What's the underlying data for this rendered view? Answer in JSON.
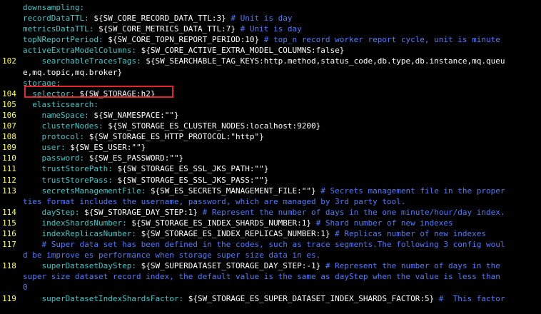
{
  "editor": {
    "highlight_color": "#e0262a",
    "colors": {
      "key": "#3fc7c7",
      "value": "#ffffff",
      "comment": "#4e7bff",
      "line_number": "#ffff55"
    },
    "lines": [
      {
        "num": "",
        "indent": "",
        "key": "downsampling:",
        "value": "",
        "comment": ""
      },
      {
        "num": "",
        "indent": "",
        "key": "recordDataTTL:",
        "value": " ${SW_CORE_RECORD_DATA_TTL:3}",
        "comment": " # Unit is day"
      },
      {
        "num": "",
        "indent": "",
        "key": "metricsDataTTL:",
        "value": " ${SW_CORE_METRICS_DATA_TTL:7}",
        "comment": " # Unit is day"
      },
      {
        "num": "",
        "indent": "",
        "key": "topNReportPeriod:",
        "value": " ${SW_CORE_TOPN_REPORT_PERIOD:10}",
        "comment": " # top_n record worker report cycle, unit is minute"
      },
      {
        "num": "",
        "indent": "",
        "key": "activeExtraModelColumns:",
        "value": " ${SW_CORE_ACTIVE_EXTRA_MODEL_COLUMNS:false}",
        "comment": ""
      },
      {
        "num": "102",
        "indent": "    ",
        "key": "searchableTracesTags:",
        "value": " ${SW_SEARCHABLE_TAG_KEYS:http.method,status_code,db.type,db.instance,mq.queu",
        "comment": ""
      },
      {
        "num": "",
        "indent": "",
        "key": "",
        "value": "e,mq.topic,mq.broker}",
        "comment": ""
      },
      {
        "num": "",
        "indent": "",
        "key": "storage:",
        "value": "",
        "comment": ""
      },
      {
        "num": "104",
        "indent": "  ",
        "key": "selector:",
        "value": " ${SW_STORAGE:h2}",
        "comment": ""
      },
      {
        "num": "105",
        "indent": "  ",
        "key": "elasticsearch:",
        "value": "",
        "comment": ""
      },
      {
        "num": "106",
        "indent": "    ",
        "key": "nameSpace:",
        "value": " ${SW_NAMESPACE:\"\"}",
        "comment": ""
      },
      {
        "num": "107",
        "indent": "    ",
        "key": "clusterNodes:",
        "value": " ${SW_STORAGE_ES_CLUSTER_NODES:localhost:9200}",
        "comment": ""
      },
      {
        "num": "108",
        "indent": "    ",
        "key": "protocol:",
        "value": " ${SW_STORAGE_ES_HTTP_PROTOCOL:\"http\"}",
        "comment": ""
      },
      {
        "num": "109",
        "indent": "    ",
        "key": "user:",
        "value": " ${SW_ES_USER:\"\"}",
        "comment": ""
      },
      {
        "num": "110",
        "indent": "    ",
        "key": "password:",
        "value": " ${SW_ES_PASSWORD:\"\"}",
        "comment": ""
      },
      {
        "num": "111",
        "indent": "    ",
        "key": "trustStorePath:",
        "value": " ${SW_STORAGE_ES_SSL_JKS_PATH:\"\"}",
        "comment": ""
      },
      {
        "num": "112",
        "indent": "    ",
        "key": "trustStorePass:",
        "value": " ${SW_STORAGE_ES_SSL_JKS_PASS:\"\"}",
        "comment": ""
      },
      {
        "num": "113",
        "indent": "    ",
        "key": "secretsManagementFile:",
        "value": " ${SW_ES_SECRETS_MANAGEMENT_FILE:\"\"}",
        "comment": " # Secrets management file in the proper"
      },
      {
        "num": "",
        "indent": "",
        "key": "",
        "value": "",
        "comment": "ties format includes the username, password, which are managed by 3rd party tool."
      },
      {
        "num": "114",
        "indent": "    ",
        "key": "dayStep:",
        "value": " ${SW_STORAGE_DAY_STEP:1}",
        "comment": " # Represent the number of days in the one minute/hour/day index."
      },
      {
        "num": "115",
        "indent": "    ",
        "key": "indexShardsNumber:",
        "value": " ${SW_STORAGE_ES_INDEX_SHARDS_NUMBER:1}",
        "comment": " # Shard number of new indexes"
      },
      {
        "num": "116",
        "indent": "    ",
        "key": "indexReplicasNumber:",
        "value": " ${SW_STORAGE_ES_INDEX_REPLICAS_NUMBER:1}",
        "comment": " # Replicas number of new indexes"
      },
      {
        "num": "117",
        "indent": "    ",
        "key": "",
        "value": "",
        "comment": "# Super data set has been defined in the codes, such as trace segments.The following 3 config woul"
      },
      {
        "num": "",
        "indent": "",
        "key": "",
        "value": "",
        "comment": "d be improve es performance when storage super size data in es."
      },
      {
        "num": "118",
        "indent": "    ",
        "key": "superDatasetDayStep:",
        "value": " ${SW_SUPERDATASET_STORAGE_DAY_STEP:-1}",
        "comment": " # Represent the number of days in the"
      },
      {
        "num": "",
        "indent": "",
        "key": "",
        "value": "",
        "comment": "super size dataset record index, the default value is the same as dayStep when the value is less than"
      },
      {
        "num": "",
        "indent": "",
        "key": "",
        "value": "",
        "comment": "0"
      },
      {
        "num": "119",
        "indent": "    ",
        "key": "superDatasetIndexShardsFactor:",
        "value": " ${SW_STORAGE_ES_SUPER_DATASET_INDEX_SHARDS_FACTOR:5}",
        "comment": " #  This factor"
      }
    ]
  }
}
